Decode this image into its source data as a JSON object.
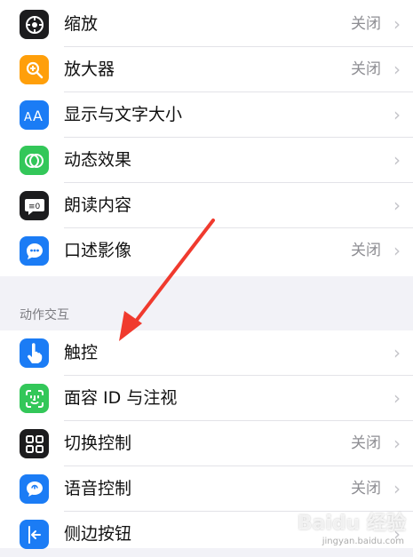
{
  "group1": {
    "rows": [
      {
        "label": "缩放",
        "value": "关闭",
        "icon": "zoom-icon",
        "color": "#1c1c1e"
      },
      {
        "label": "放大器",
        "value": "关闭",
        "icon": "magnifier-icon",
        "color": "#ff9f0a"
      },
      {
        "label": "显示与文字大小",
        "value": "",
        "icon": "text-size-icon",
        "color": "#1b7cf5"
      },
      {
        "label": "动态效果",
        "value": "",
        "icon": "motion-icon",
        "color": "#33c759"
      },
      {
        "label": "朗读内容",
        "value": "",
        "icon": "speech-bubble-icon",
        "color": "#1c1c1e"
      },
      {
        "label": "口述影像",
        "value": "关闭",
        "icon": "audio-description-icon",
        "color": "#1b7cf5"
      }
    ]
  },
  "section": {
    "header": "动作交互"
  },
  "group2": {
    "rows": [
      {
        "label": "触控",
        "value": "",
        "icon": "touch-icon",
        "color": "#1b7cf5"
      },
      {
        "label": "面容 ID 与注视",
        "value": "",
        "icon": "face-id-icon",
        "color": "#33c759"
      },
      {
        "label": "切换控制",
        "value": "关闭",
        "icon": "switch-control-icon",
        "color": "#1c1c1e"
      },
      {
        "label": "语音控制",
        "value": "关闭",
        "icon": "voice-control-icon",
        "color": "#1b7cf5"
      },
      {
        "label": "侧边按钮",
        "value": "",
        "icon": "side-button-icon",
        "color": "#1b7cf5"
      }
    ]
  },
  "chevron": "›",
  "watermark": {
    "text": "Baidu 经验",
    "sub": "jingyan.baidu.com"
  }
}
